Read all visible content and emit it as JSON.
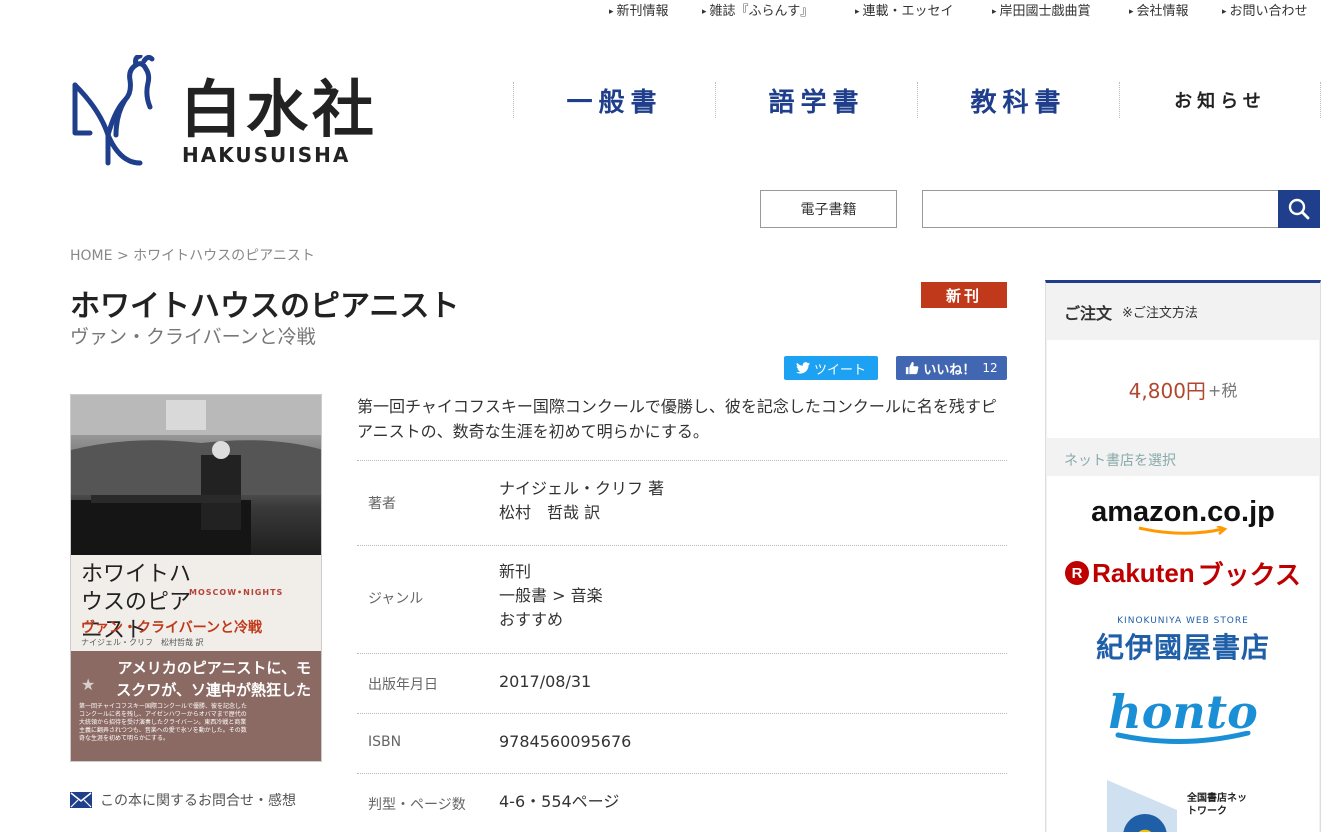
{
  "top_nav": [
    "新刊情報",
    "雑誌『ふらんす』",
    "連載・エッセイ",
    "岸田國士戯曲賞",
    "会社情報",
    "お問い合わせ"
  ],
  "logo": {
    "kanji": "白水社",
    "roman": "HAKUSUISHA"
  },
  "main_nav": [
    "一般書",
    "語学書",
    "教科書",
    "お知らせ"
  ],
  "ebook_label": "電子書籍",
  "search": {
    "placeholder": ""
  },
  "breadcrumb": {
    "home": "HOME",
    "separator": ">",
    "current": "ホワイトハウスのピアニスト"
  },
  "book": {
    "title": "ホワイトハウスのピアニスト",
    "subtitle": "ヴァン・クライバーンと冷戦",
    "badge": "新刊",
    "description": "第一回チャイコフスキー国際コンクールで優勝し、彼を記念したコンクールに名を残すピアニストの、数奇な生涯を初めて明らかにする。",
    "cover": {
      "title": "ホワイトハウスのピアニスト",
      "en_title": "MOSCOW•NIGHTS",
      "subtitle": "ヴァン・クライバーンと冷戦",
      "authors": "ナイジェル・クリフ　松村哲哉 訳",
      "catch": "アメリカのピアニストに、モスクワが、ソ連中が熱狂した",
      "blurb": "第一回チャイコフスキー国際コンクールで優勝、彼を記念したコンクールに名を残し、アイゼンハワーからオバマまで歴代の大統領から招待を受け演奏したクライバーン。東西冷戦と商業主義に翻弄されつつも、音楽への愛で氷ソを動かした。その数奇な生涯を初めて明らかにする。"
    },
    "info": [
      {
        "label": "著者",
        "values": [
          "ナイジェル・クリフ 著",
          "松村　哲哉 訳"
        ]
      },
      {
        "label": "ジャンル",
        "values": [
          "新刊",
          "一般書 > 音楽",
          "おすすめ"
        ]
      },
      {
        "label": "出版年月日",
        "values": [
          "2017/08/31"
        ]
      },
      {
        "label": "ISBN",
        "values": [
          "9784560095676"
        ]
      },
      {
        "label": "判型・ページ数",
        "values": [
          "4-6・554ページ"
        ]
      }
    ]
  },
  "social": {
    "tweet": "ツイート",
    "like": "いいね！",
    "like_count": "12"
  },
  "contact_label": "この本に関するお問合せ・感想",
  "order": {
    "title": "ご注文",
    "how": "※ご注文方法",
    "price": "4,800円",
    "tax": "+税",
    "select_label": "ネット書店を選択",
    "stores": {
      "amazon": "amazon.co.jp",
      "rakuten_r": "R",
      "rakuten": "Rakuten",
      "rakuten_books": "ブックス",
      "kino_small": "KINOKUNIYA WEB STORE",
      "kino": "紀伊國屋書店",
      "honto": "honto",
      "ehon_letter": "e",
      "ehon": "全国書店ネットワーク"
    }
  },
  "colors": {
    "brand_blue": "#1f3f8c",
    "badge_red": "#c0391b",
    "price_red": "#b0472e"
  }
}
